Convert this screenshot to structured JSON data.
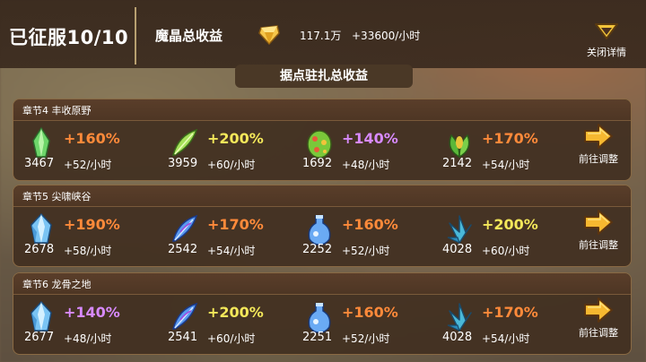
{
  "header": {
    "conquered": "已征服10/10",
    "income_label": "魔晶总收益",
    "income_total": "117.1万",
    "income_rate": "+33600/小时",
    "close_label": "关闭详情"
  },
  "section_title": "据点驻扎总收益",
  "colors": {
    "orange": "#ff8a3a",
    "yellow": "#f4e85a",
    "purple": "#d88aff"
  },
  "chapters": [
    {
      "title": "章节4 丰收原野",
      "goto_label": "前往调整",
      "items": [
        {
          "icon": "green-leaf-crystal-icon",
          "count": "3467",
          "pct": "+160%",
          "pct_color": "orange",
          "rate": "+52/小时"
        },
        {
          "icon": "green-feather-icon",
          "count": "3959",
          "pct": "+200%",
          "pct_color": "yellow",
          "rate": "+60/小时"
        },
        {
          "icon": "spotted-egg-icon",
          "count": "1692",
          "pct": "+140%",
          "pct_color": "purple",
          "rate": "+48/小时"
        },
        {
          "icon": "green-seed-pod-icon",
          "count": "2142",
          "pct": "+170%",
          "pct_color": "orange",
          "rate": "+54/小时"
        }
      ]
    },
    {
      "title": "章节5 尖啸峡谷",
      "goto_label": "前往调整",
      "items": [
        {
          "icon": "blue-crystal-icon",
          "count": "2678",
          "pct": "+190%",
          "pct_color": "orange",
          "rate": "+58/小时"
        },
        {
          "icon": "blue-feather-icon",
          "count": "2542",
          "pct": "+170%",
          "pct_color": "orange",
          "rate": "+54/小时"
        },
        {
          "icon": "blue-bottle-icon",
          "count": "2252",
          "pct": "+160%",
          "pct_color": "orange",
          "rate": "+52/小时"
        },
        {
          "icon": "blue-leaf-icon",
          "count": "4028",
          "pct": "+200%",
          "pct_color": "yellow",
          "rate": "+60/小时"
        }
      ]
    },
    {
      "title": "章节6 龙骨之地",
      "goto_label": "前往调整",
      "items": [
        {
          "icon": "blue-crystal-icon",
          "count": "2677",
          "pct": "+140%",
          "pct_color": "purple",
          "rate": "+48/小时"
        },
        {
          "icon": "blue-feather-icon",
          "count": "2541",
          "pct": "+200%",
          "pct_color": "yellow",
          "rate": "+60/小时"
        },
        {
          "icon": "blue-bottle-icon",
          "count": "2251",
          "pct": "+160%",
          "pct_color": "orange",
          "rate": "+52/小时"
        },
        {
          "icon": "blue-leaf-icon",
          "count": "4028",
          "pct": "+170%",
          "pct_color": "orange",
          "rate": "+54/小时"
        }
      ]
    }
  ]
}
